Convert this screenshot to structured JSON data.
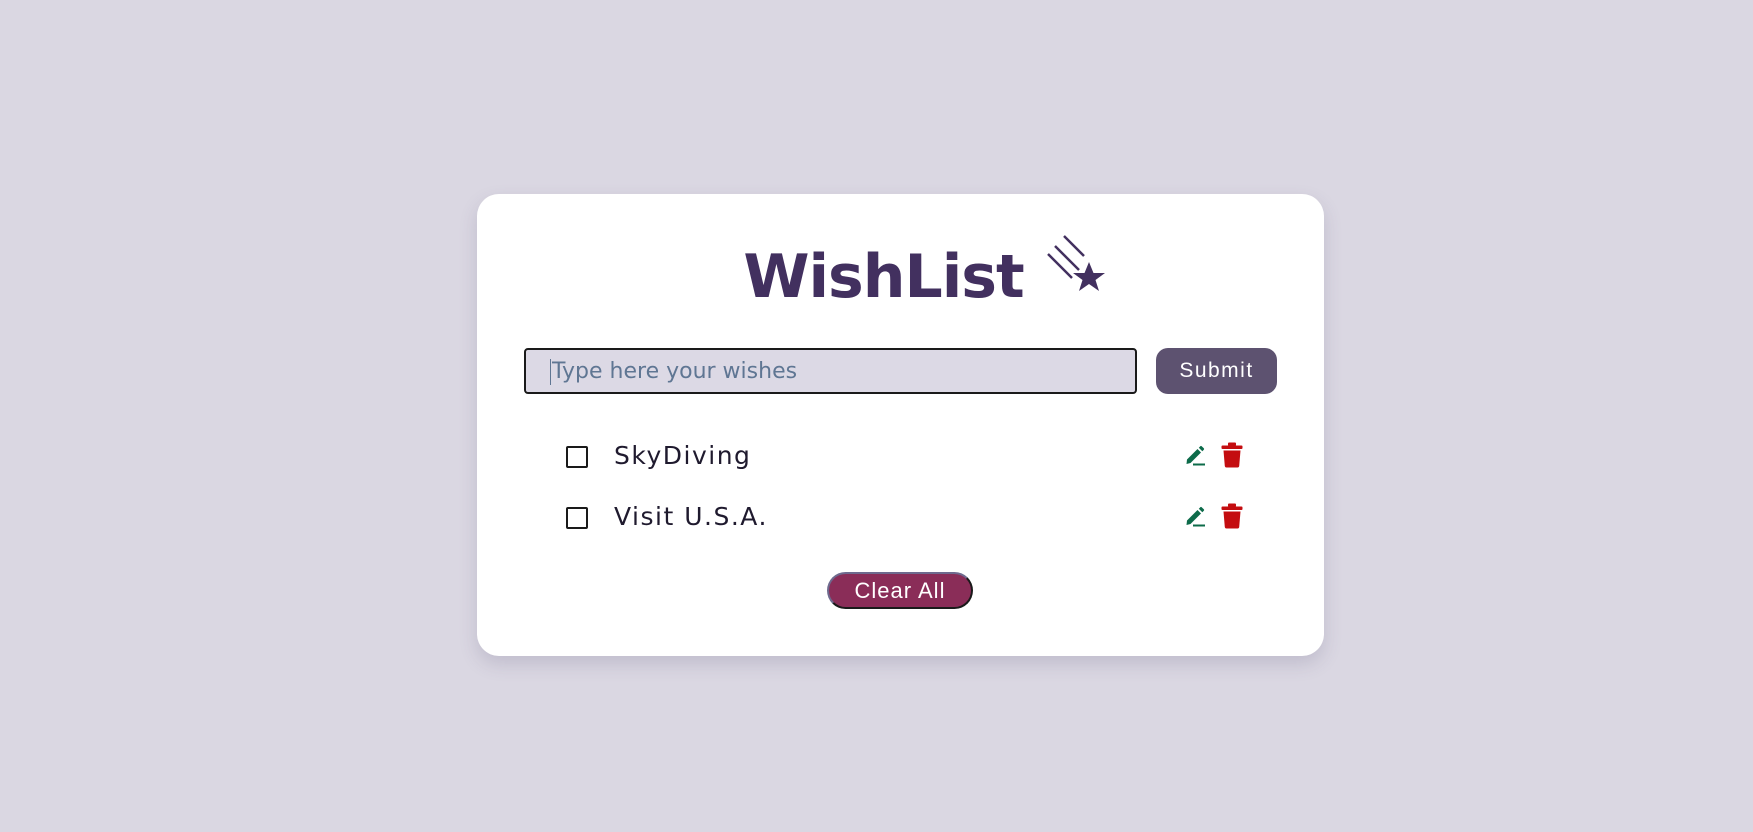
{
  "header": {
    "title": "WishList",
    "icon": "shooting-star-icon"
  },
  "form": {
    "placeholder": "Type here your wishes",
    "value": "",
    "submit_label": "Submit"
  },
  "wishes": [
    {
      "label": "SkyDiving",
      "checked": false
    },
    {
      "label": "Visit U.S.A.",
      "checked": false
    }
  ],
  "actions": {
    "clear_all_label": "Clear All"
  },
  "colors": {
    "background": "#dad7e2",
    "title": "#42305f",
    "submit_button": "#5d5270",
    "input_background": "#dcd9e5",
    "edit_icon": "#0d6b4a",
    "delete_icon": "#c40d10",
    "clear_button": "#8a2d58"
  }
}
